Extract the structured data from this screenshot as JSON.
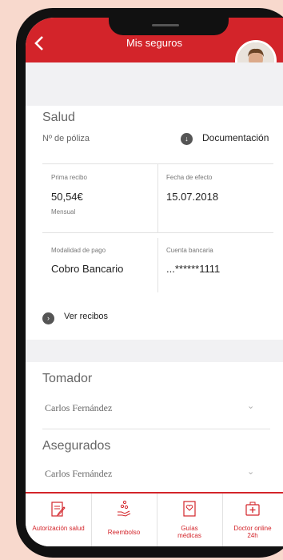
{
  "header": {
    "title": "Mis seguros"
  },
  "policy": {
    "product": "Salud",
    "policy_label": "Nº de póliza",
    "documentation_label": "Documentación",
    "fields": [
      {
        "label": "Prima recibo",
        "value": "50,54€",
        "sub": "Mensual"
      },
      {
        "label": "Fecha de efecto",
        "value": "15.07.2018"
      },
      {
        "label": "Modalidad de pago",
        "value": "Cobro Bancario"
      },
      {
        "label": "Cuenta bancaria",
        "value": "...******1111"
      }
    ],
    "receipts_link": "Ver recibos"
  },
  "holder": {
    "title": "Tomador",
    "name": "Carlos Fernández"
  },
  "insured": {
    "title": "Asegurados",
    "name": "Carlos Fernández"
  },
  "tabs": [
    {
      "label": "Autorización salud",
      "icon": "edit-document-icon"
    },
    {
      "label": "Reembolso",
      "icon": "hand-coins-icon"
    },
    {
      "label": "Guías médicas",
      "icon": "heart-book-icon"
    },
    {
      "label": "Doctor online 24h",
      "icon": "medical-kit-icon"
    }
  ],
  "colors": {
    "brand": "#d3242a",
    "background": "#f8d9cd"
  }
}
